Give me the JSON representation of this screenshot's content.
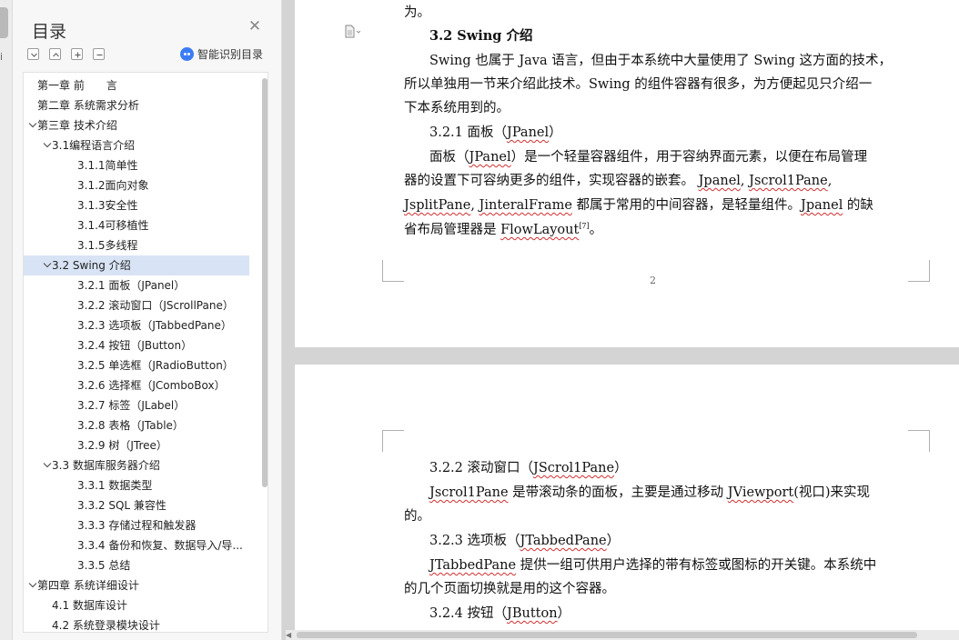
{
  "toc": {
    "title": "目录",
    "smart_toc_label": "智能识别目录",
    "items": [
      {
        "label": "第一章 前　　言",
        "level": 0,
        "chevron": false,
        "selected": false
      },
      {
        "label": "第二章  系统需求分析",
        "level": 0,
        "chevron": false,
        "selected": false
      },
      {
        "label": "第三章  技术介绍",
        "level": 0,
        "chevron": true,
        "selected": false
      },
      {
        "label": "3.1编程语言介绍",
        "level": 1,
        "chevron": true,
        "selected": false
      },
      {
        "label": "3.1.1简单性",
        "level": 2,
        "chevron": false,
        "selected": false
      },
      {
        "label": "3.1.2面向对象",
        "level": 2,
        "chevron": false,
        "selected": false
      },
      {
        "label": "3.1.3安全性",
        "level": 2,
        "chevron": false,
        "selected": false
      },
      {
        "label": "3.1.4可移植性",
        "level": 2,
        "chevron": false,
        "selected": false
      },
      {
        "label": "3.1.5多线程",
        "level": 2,
        "chevron": false,
        "selected": false
      },
      {
        "label": "3.2 Swing 介绍",
        "level": 1,
        "chevron": true,
        "selected": true
      },
      {
        "label": "3.2.1  面板（JPanel）",
        "level": 2,
        "chevron": false,
        "selected": false
      },
      {
        "label": "3.2.2  滚动窗口（JScrollPane）",
        "level": 2,
        "chevron": false,
        "selected": false
      },
      {
        "label": "3.2.3  选项板（JTabbedPane）",
        "level": 2,
        "chevron": false,
        "selected": false
      },
      {
        "label": "3.2.4  按钮（JButton）",
        "level": 2,
        "chevron": false,
        "selected": false
      },
      {
        "label": "3.2.5  单选框（JRadioButton）",
        "level": 2,
        "chevron": false,
        "selected": false
      },
      {
        "label": "3.2.6  选择框（JComboBox）",
        "level": 2,
        "chevron": false,
        "selected": false
      },
      {
        "label": "3.2.7  标签（JLabel）",
        "level": 2,
        "chevron": false,
        "selected": false
      },
      {
        "label": "3.2.8  表格（JTable）",
        "level": 2,
        "chevron": false,
        "selected": false
      },
      {
        "label": "3.2.9  树（JTree）",
        "level": 2,
        "chevron": false,
        "selected": false
      },
      {
        "label": "3.3  数据库服务器介绍",
        "level": 1,
        "chevron": true,
        "selected": false
      },
      {
        "label": "3.3.1  数据类型",
        "level": 2,
        "chevron": false,
        "selected": false
      },
      {
        "label": "3.3.2 SQL 兼容性",
        "level": 2,
        "chevron": false,
        "selected": false
      },
      {
        "label": "3.3.3  存储过程和触发器",
        "level": 2,
        "chevron": false,
        "selected": false
      },
      {
        "label": "3.3.4  备份和恢复、数据导入/导...",
        "level": 2,
        "chevron": false,
        "selected": false
      },
      {
        "label": "3.3.5  总结",
        "level": 2,
        "chevron": false,
        "selected": false
      },
      {
        "label": "第四章  系统详细设计",
        "level": 0,
        "chevron": true,
        "selected": false
      },
      {
        "label": "4.1  数据库设计",
        "level": 1,
        "chevron": false,
        "selected": false
      },
      {
        "label": "4.2  系统登录模块设计",
        "level": 1,
        "chevron": false,
        "selected": false
      }
    ]
  },
  "page1": {
    "top_fragment": "为。",
    "heading": "3.2 Swing 介绍",
    "p1_l1": "Swing 也属于 Java 语言，但由于本系统中大量使用了 Swing 这方面的技术，",
    "p1_l2": "所以单独用一节来介绍此技术。Swing 的组件容器有很多，为方便起见只介绍一",
    "p1_l3": "下本系统用到的。",
    "sub_heading_a": "3.2.1 面板（",
    "sub_heading_w": "JPanel",
    "sub_heading_b": "）",
    "p2_l1_a": "面板（",
    "p2_l1_w": "JPanel",
    "p2_l1_b": "）是一个轻量容器组件，用于容纳界面元素，以便在布局管理",
    "p2_l2_a": "器的设置下可容纳更多的组件，实现容器的嵌套。 ",
    "p2_l2_w1": "Jpanel",
    "p2_l2_s": ", ",
    "p2_l2_w2": "Jscrol1Pane",
    "p2_l2_b": ",",
    "p2_l3_w1": "JsplitPane",
    "p2_l3_s": ", ",
    "p2_l3_w2": "JinteralFrame",
    "p2_l3_b": " 都属于常用的中间容器，是轻量组件。",
    "p2_l3_w3": "Jpanel",
    "p2_l3_c": " 的缺",
    "p2_l4_a": "省布局管理器是 ",
    "p2_l4_w": "FlowLayout",
    "p2_l4_sup": "[7]",
    "p2_l4_b": "。",
    "page_number": "2"
  },
  "page2": {
    "h_a": "3.2.2 滚动窗口（",
    "h_a_w": "JScrol1Pane",
    "h_a_b": "）",
    "pa_l1_w": "Jscrol1Pane",
    "pa_l1_b": " 是带滚动条的面板，主要是通过移动 ",
    "pa_l1_w2": "JViewport",
    "pa_l1_c": "(视口)来实现",
    "pa_l2": "的。",
    "h_b": "3.2.3 选项板（",
    "h_b_w": "JTabbedPane",
    "h_b_b": "）",
    "pb_l1_w": "JTabbedPane",
    "pb_l1_b": " 提供一组可供用户选择的带有标签或图标的开关键。本系统中",
    "pb_l2": "的几个页面切换就是用的这个容器。",
    "h_c": "3.2.4 按钮（",
    "h_c_w": "JButton",
    "h_c_b": "）"
  }
}
